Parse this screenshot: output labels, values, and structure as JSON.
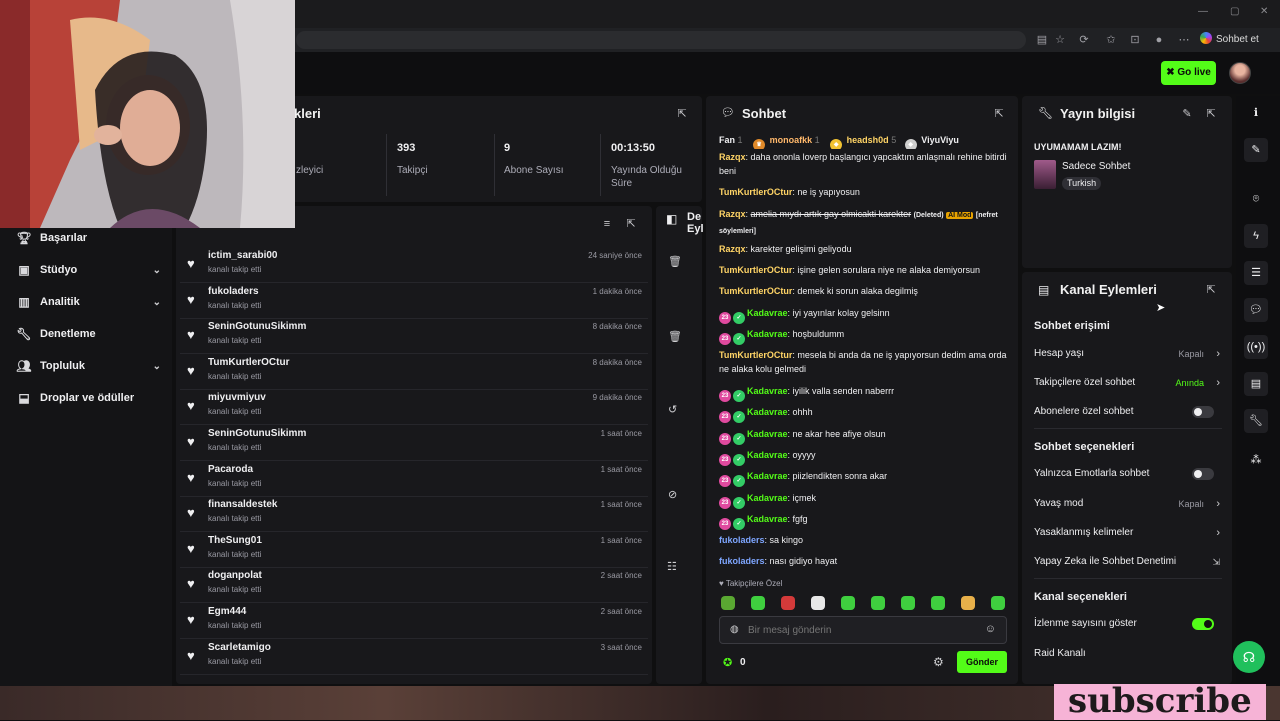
{
  "browser": {
    "sohbet_et": "Sohbet et"
  },
  "header": {
    "go_live": "Go live"
  },
  "sidebar": {
    "items": [
      {
        "label": "Başarılar",
        "icon": "trophy-icon"
      },
      {
        "label": "Stüdyo",
        "icon": "video-icon"
      },
      {
        "label": "Analitik",
        "icon": "chart-icon"
      },
      {
        "label": "Denetleme",
        "icon": "wrench-icon"
      },
      {
        "label": "Topluluk",
        "icon": "users-icon"
      },
      {
        "label": "Droplar ve ödüller",
        "icon": "gift-icon"
      }
    ]
  },
  "stats": {
    "title_fragment": "kleri",
    "viewers_label_fragment": "zleyici",
    "followers": {
      "value": "393",
      "label": "Takipçi"
    },
    "subs": {
      "value": "9",
      "label": "Abone Sayısı"
    },
    "uptime": {
      "value": "00:13:50",
      "label": "Yayında Olduğu Süre"
    }
  },
  "followers_list": [
    {
      "name": "ictim_sarabi00",
      "sub": "kanalı takip etti",
      "time": "24 saniye önce"
    },
    {
      "name": "fukoladers",
      "sub": "kanalı takip etti",
      "time": "1 dakika önce"
    },
    {
      "name": "SeninGotunuSikimm",
      "sub": "kanalı takip etti",
      "time": "8 dakika önce"
    },
    {
      "name": "TumKurtlerOCtur",
      "sub": "kanalı takip etti",
      "time": "8 dakika önce"
    },
    {
      "name": "miyuvmiyuv",
      "sub": "kanalı takip etti",
      "time": "9 dakika önce"
    },
    {
      "name": "SeninGotunuSikimm",
      "sub": "kanalı takip etti",
      "time": "1 saat önce"
    },
    {
      "name": "Pacaroda",
      "sub": "kanalı takip etti",
      "time": "1 saat önce"
    },
    {
      "name": "finansaldestek",
      "sub": "kanalı takip etti",
      "time": "1 saat önce"
    },
    {
      "name": "TheSung01",
      "sub": "kanalı takip etti",
      "time": "1 saat önce"
    },
    {
      "name": "doganpolat",
      "sub": "kanalı takip etti",
      "time": "2 saat önce"
    },
    {
      "name": "Egm444",
      "sub": "kanalı takip etti",
      "time": "2 saat önce"
    },
    {
      "name": "Scarletamigo",
      "sub": "kanalı takip etti",
      "time": "3 saat önce"
    }
  ],
  "events_panel": {
    "title_fragment": "De Eyl"
  },
  "chat": {
    "title": "Sohbet",
    "top_bar": {
      "fan": "Fan",
      "fan_count": "1",
      "u1": "monoafkk",
      "u1_count": "1",
      "u2": "headsh0d",
      "u2_count": "5",
      "u3": "ViyuViyu"
    },
    "messages": [
      {
        "user": "Razqx",
        "text": "daha ononla loverp başlangıcı yapcaktım anlaşmalı rehine bitirdi beni"
      },
      {
        "user": "TumKurtlerOCtur",
        "text": "ne iş yapıyosun"
      },
      {
        "user": "Razqx",
        "text_strike": "amelia mıydı artık gay olmicakti karekter",
        "deleted": "(Deleted)",
        "aimod": "AI Mod",
        "reason": "[nefret söylemleri]"
      },
      {
        "user": "Razqx",
        "text": "karekter gelişimi geliyodu"
      },
      {
        "user": "TumKurtlerOCtur",
        "text": "işine gelen sorulara niye ne alaka demiyorsun"
      },
      {
        "user": "TumKurtlerOCtur",
        "text": "demek ki sorun alaka degilmiş"
      },
      {
        "user": "Kadavrae",
        "text": "iyi yayınlar kolay gelsinn"
      },
      {
        "user": "Kadavrae",
        "text": "hoşbuldumm"
      },
      {
        "user": "TumKurtlerOCtur",
        "text": "mesela bi anda da ne iş yapıyorsun dedim ama orda ne alaka kolu gelmedi"
      },
      {
        "user": "Kadavrae",
        "text": "iyilik valla senden naberrr"
      },
      {
        "user": "Kadavrae",
        "text": "ohhh"
      },
      {
        "user": "Kadavrae",
        "text": "ne akar hee afiye olsun"
      },
      {
        "user": "Kadavrae",
        "text": "oyyyy"
      },
      {
        "user": "Kadavrae",
        "text": "piizlendikten sonra akar"
      },
      {
        "user": "Kadavrae",
        "text": "içmek"
      },
      {
        "user": "Kadavrae",
        "text": "fgfg"
      },
      {
        "user": "fukoladers",
        "text": "sa kingo"
      },
      {
        "user": "fukoladers",
        "text": "nası gidiyo hayat"
      }
    ],
    "badge_num": "23",
    "followers_only": "Takipçilere Özel",
    "placeholder": "Bir mesaj gönderin",
    "points": "0",
    "send": "Gönder"
  },
  "stream_info": {
    "title": "Yayın bilgisi",
    "stream_title": "UYUMAMAM LAZIM!",
    "category": "Sadece Sohbet",
    "language": "Turkish"
  },
  "channel_actions": {
    "title": "Kanal Eylemleri",
    "chat_access": "Sohbet erişimi",
    "account_age": {
      "label": "Hesap yaşı",
      "value": "Kapalı"
    },
    "followers_chat": {
      "label": "Takipçilere özel sohbet",
      "value": "Anında"
    },
    "subs_chat": {
      "label": "Abonelere özel sohbet"
    },
    "chat_options": "Sohbet seçenekleri",
    "emote_only": {
      "label": "Yalnızca Emotlarla sohbet"
    },
    "slow_mode": {
      "label": "Yavaş mod",
      "value": "Kapalı"
    },
    "banned_words": {
      "label": "Yasaklanmış kelimeler"
    },
    "ai_mod": {
      "label": "Yapay Zeka ile Sohbet Denetimi"
    },
    "channel_options": "Kanal seçenekleri",
    "show_views": {
      "label": "İzlenme sayısını göster"
    },
    "raid": {
      "label": "Raid Kanalı"
    }
  },
  "overlay": {
    "subscribe": "subscribe"
  },
  "colors": {
    "accent": "#53fc18",
    "panel": "#18181b",
    "background": "#0f0f10"
  }
}
